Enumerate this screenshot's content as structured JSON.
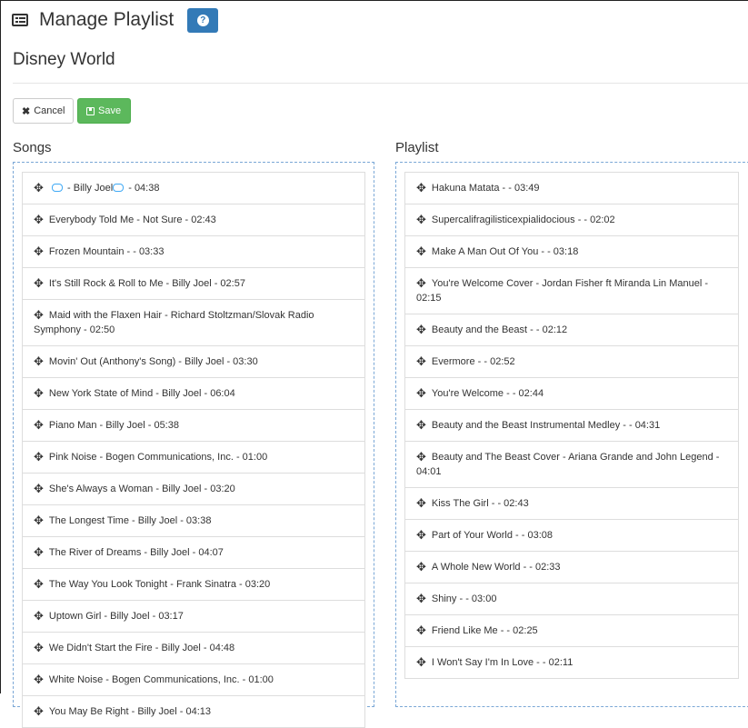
{
  "header": {
    "title": "Manage Playlist",
    "help_icon": "question-circle-icon"
  },
  "playlist_name": "Disney World",
  "toolbar": {
    "cancel_label": "Cancel",
    "save_label": "Save"
  },
  "colors": {
    "primary": "#337ab7",
    "success": "#5cb85c",
    "panel_border": "#7aa7d6",
    "cd_icon": "#3fa9f5"
  },
  "songs": {
    "title": "Songs",
    "first_item": {
      "prefix": "- Billy Joel",
      "suffix": "- 04:38"
    },
    "items": [
      "Everybody Told Me - Not Sure - 02:43",
      "Frozen Mountain - - 03:33",
      "It's Still Rock & Roll to Me - Billy Joel - 02:57",
      "Maid with the Flaxen Hair - Richard Stoltzman/Slovak Radio Symphony - 02:50",
      "Movin' Out (Anthony's Song) - Billy Joel - 03:30",
      "New York State of Mind - Billy Joel - 06:04",
      "Piano Man - Billy Joel - 05:38",
      "Pink Noise - Bogen Communications, Inc. - 01:00",
      "She's Always a Woman - Billy Joel - 03:20",
      "The Longest Time - Billy Joel - 03:38",
      "The River of Dreams - Billy Joel - 04:07",
      "The Way You Look Tonight - Frank Sinatra - 03:20",
      "Uptown Girl - Billy Joel - 03:17",
      "We Didn't Start the Fire - Billy Joel - 04:48",
      "White Noise - Bogen Communications, Inc. - 01:00",
      "You May Be Right - Billy Joel - 04:13"
    ]
  },
  "playlist": {
    "title": "Playlist",
    "items": [
      "Hakuna Matata - - 03:49",
      "Supercalifragilisticexpialidocious - - 02:02",
      "Make A Man Out Of You - - 03:18",
      "You're Welcome Cover - Jordan Fisher ft Miranda Lin Manuel - 02:15",
      "Beauty and the Beast - - 02:12",
      "Evermore - - 02:52",
      "You're Welcome - - 02:44",
      "Beauty and the Beast Instrumental Medley - - 04:31",
      "Beauty and The Beast Cover - Ariana Grande and John Legend - 04:01",
      "Kiss The Girl - - 02:43",
      "Part of Your World - - 03:08",
      "A Whole New World - - 02:33",
      "Shiny - - 03:00",
      "Friend Like Me - - 02:25",
      "I Won't Say I'm In Love - - 02:11"
    ]
  }
}
